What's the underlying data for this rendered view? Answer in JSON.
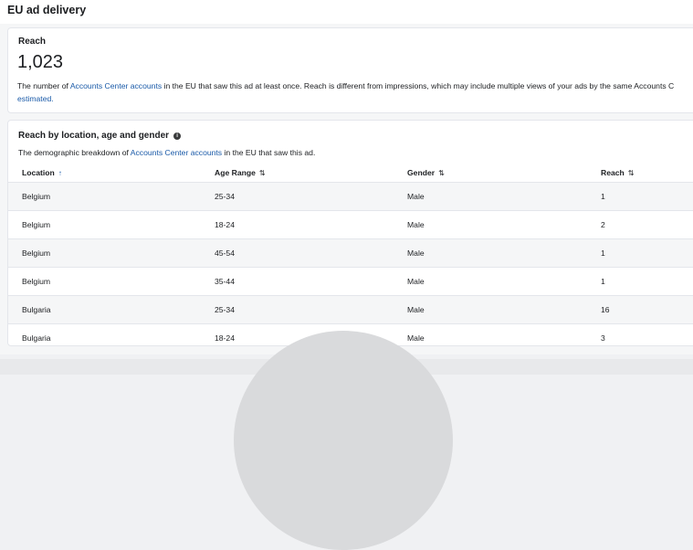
{
  "header": {
    "title": "EU ad delivery"
  },
  "reach": {
    "label": "Reach",
    "value": "1,023",
    "desc_prefix": "The number of ",
    "desc_link": "Accounts Center accounts",
    "desc_suffix": " in the EU that saw this ad at least once. Reach is different from impressions, which may include multiple views of your ads by the same Accounts C",
    "desc_line2_link": "estimated."
  },
  "breakdown": {
    "title": "Reach by location, age and gender",
    "desc_prefix": "The demographic breakdown of ",
    "desc_link": "Accounts Center accounts",
    "desc_suffix": " in the EU that saw this ad.",
    "columns": [
      "Location",
      "Age Range",
      "Gender",
      "Reach"
    ],
    "rows": [
      [
        "Belgium",
        "25-34",
        "Male",
        "1"
      ],
      [
        "Belgium",
        "18-24",
        "Male",
        "2"
      ],
      [
        "Belgium",
        "45-54",
        "Male",
        "1"
      ],
      [
        "Belgium",
        "35-44",
        "Male",
        "1"
      ],
      [
        "Bulgaria",
        "25-34",
        "Male",
        "16"
      ],
      [
        "Bulgaria",
        "18-24",
        "Male",
        "3"
      ]
    ]
  },
  "icons": {
    "info": "info-icon",
    "sort_asc": "arrow-up-icon",
    "sort_both": "sort-icon"
  },
  "colors": {
    "link": "#1a5aa8",
    "border": "#e4e6eb"
  }
}
